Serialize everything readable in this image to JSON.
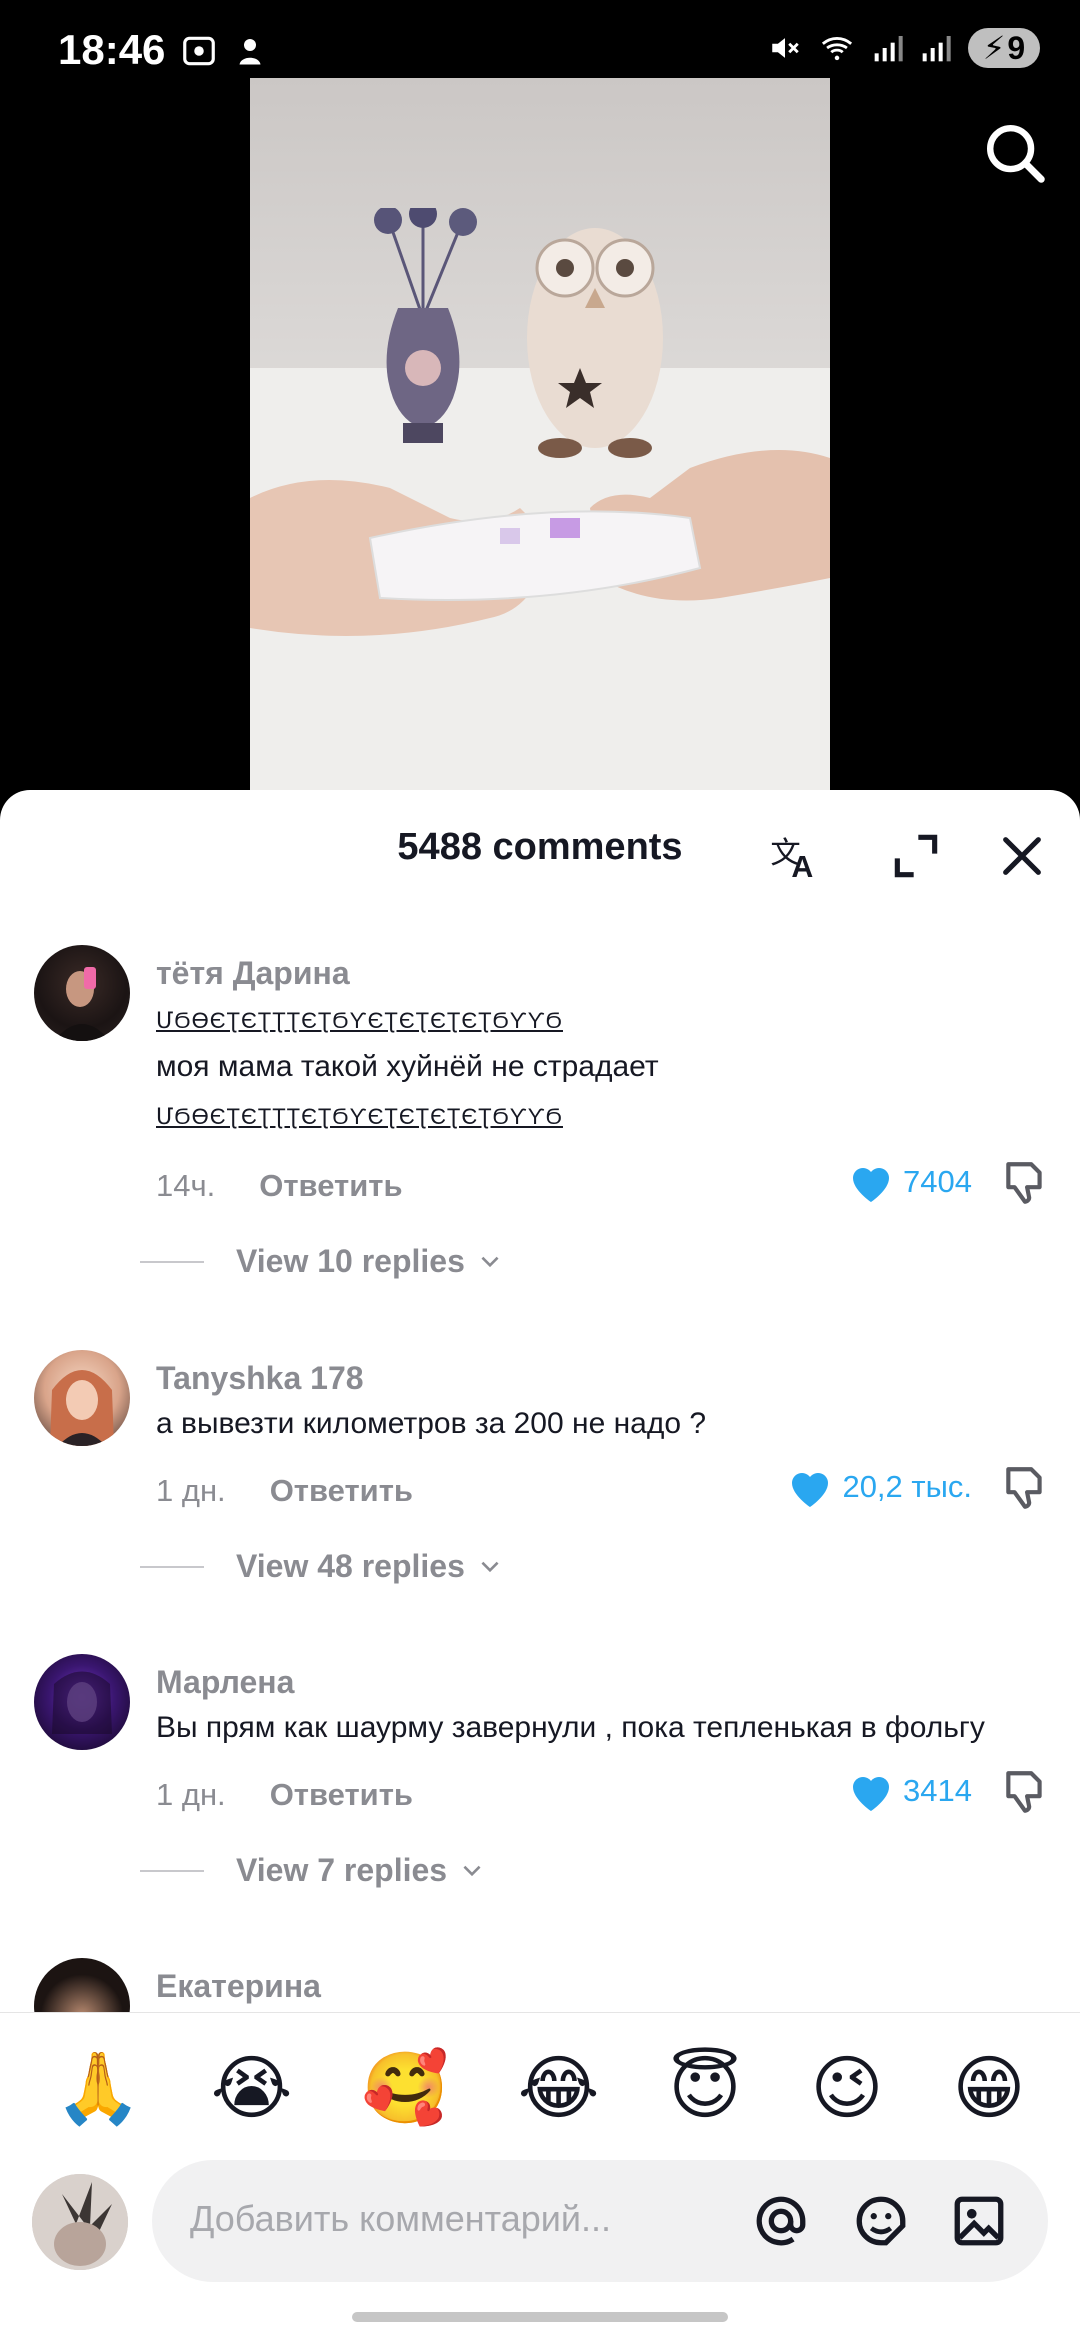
{
  "status_bar": {
    "time": "18:46",
    "battery": "9"
  },
  "comments_sheet": {
    "title": "5488 comments",
    "comments": [
      {
        "user": "тётя Дарина",
        "deco_line": "ՄϬϴЄƮЄƮƮƮЄƮϬƳЄƮЄƮЄƮЄƮϬƳƳϬ",
        "text": "моя мама такой хуйнёй не страдает",
        "time": "14ч.",
        "reply_label": "Ответить",
        "likes": "7404",
        "view_replies": "View 10 replies"
      },
      {
        "user": "Tanyshka 178",
        "text": "а вывезти километров за 200 не надо ?",
        "time": "1 дн.",
        "reply_label": "Ответить",
        "likes": "20,2 тыс.",
        "view_replies": "View 48 replies"
      },
      {
        "user": "Марлена",
        "text": "Вы прям как шаурму завернули , пока тепленькая в фольгу",
        "time": "1 дн.",
        "reply_label": "Ответить",
        "likes": "3414",
        "view_replies": "View 7 replies"
      },
      {
        "user": "Екатерина"
      }
    ]
  },
  "emoji_bar": [
    "🙏",
    "😭",
    "🥰",
    "😂",
    "😇",
    "😉",
    "😁"
  ],
  "input": {
    "placeholder": "Добавить комментарий..."
  },
  "colors": {
    "like_blue": "#2aa7f0",
    "text_dark": "#161823",
    "text_gray": "#8a8b91"
  }
}
